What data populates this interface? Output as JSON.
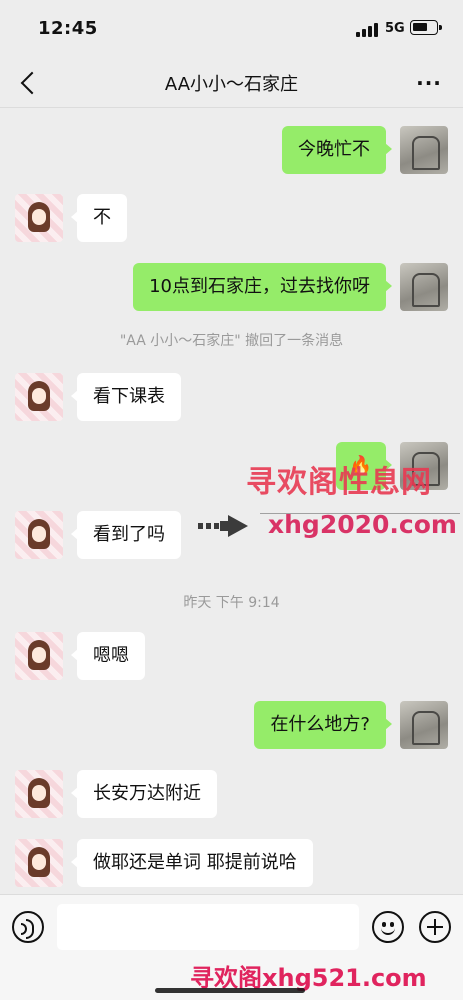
{
  "status_bar": {
    "time": "12:45",
    "network": "5G"
  },
  "navbar": {
    "title": "AA小小～石家庄",
    "more": "···"
  },
  "messages": [
    {
      "sender": "me",
      "text": "今晚忙不"
    },
    {
      "sender": "friend",
      "text": "不"
    },
    {
      "sender": "me",
      "text": "10点到石家庄，过去找你呀"
    },
    {
      "sender": "system",
      "text": "\"AA 小小～石家庄\" 撤回了一条消息"
    },
    {
      "sender": "friend",
      "text": "看下课表"
    },
    {
      "sender": "me",
      "text": "🔥",
      "kind": "emoji"
    },
    {
      "sender": "friend",
      "text": "看到了吗"
    },
    {
      "sender": "timestamp",
      "text": "昨天 下午 9:14"
    },
    {
      "sender": "friend",
      "text": "嗯嗯"
    },
    {
      "sender": "me",
      "text": "在什么地方?"
    },
    {
      "sender": "friend",
      "text": "长安万达附近"
    },
    {
      "sender": "friend",
      "text": "做耶还是单词 耶提前说哈"
    }
  ],
  "watermarks": {
    "top_cn": "寻欢阁性息网",
    "top_url": "xhg2020.com",
    "bottom": "寻欢阁xhg521.com"
  },
  "input": {
    "placeholder": ""
  }
}
